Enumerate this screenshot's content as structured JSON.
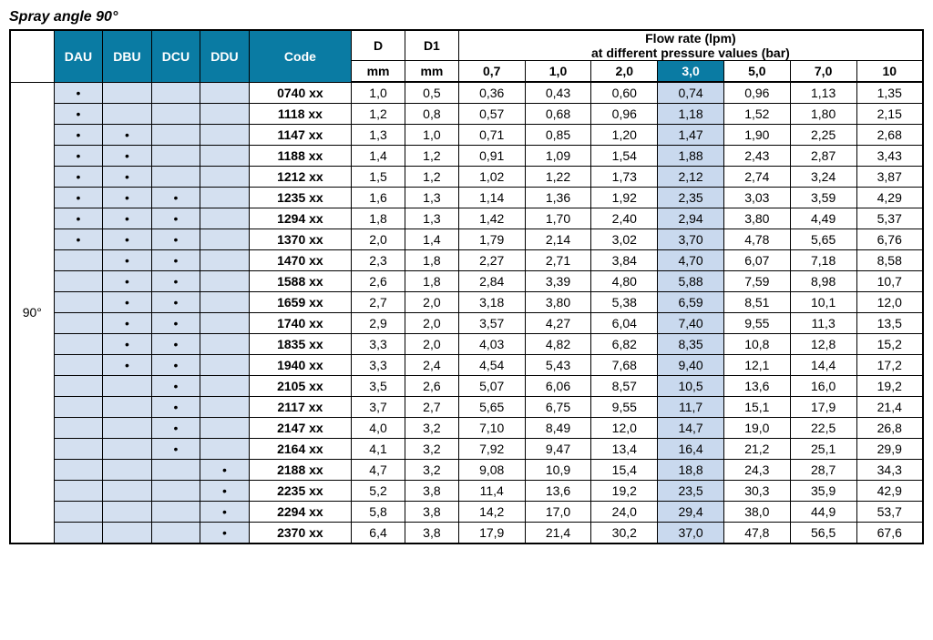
{
  "title": "Spray angle 90°",
  "angle_label": "90°",
  "headers": {
    "dau": "DAU",
    "dbu": "DBU",
    "dcu": "DCU",
    "ddu": "DDU",
    "code": "Code",
    "d": "D",
    "d1": "D1",
    "flow_title1": "Flow rate (lpm)",
    "flow_title2": "at different pressure values (bar)",
    "d_unit": "mm",
    "d1_unit": "mm",
    "pressures": [
      "0,7",
      "1,0",
      "2,0",
      "3,0",
      "5,0",
      "7,0",
      "10"
    ]
  },
  "rows": [
    {
      "dau": "•",
      "dbu": "",
      "dcu": "",
      "ddu": "",
      "code": "0740 xx",
      "d": "1,0",
      "d1": "0,5",
      "f": [
        "0,36",
        "0,43",
        "0,60",
        "0,74",
        "0,96",
        "1,13",
        "1,35"
      ]
    },
    {
      "dau": "•",
      "dbu": "",
      "dcu": "",
      "ddu": "",
      "code": "1118  xx",
      "d": "1,2",
      "d1": "0,8",
      "f": [
        "0,57",
        "0,68",
        "0,96",
        "1,18",
        "1,52",
        "1,80",
        "2,15"
      ]
    },
    {
      "dau": "•",
      "dbu": "•",
      "dcu": "",
      "ddu": "",
      "code": "1147  xx",
      "d": "1,3",
      "d1": "1,0",
      "f": [
        "0,71",
        "0,85",
        "1,20",
        "1,47",
        "1,90",
        "2,25",
        "2,68"
      ]
    },
    {
      "dau": "•",
      "dbu": "•",
      "dcu": "",
      "ddu": "",
      "code": "1188  xx",
      "d": "1,4",
      "d1": "1,2",
      "f": [
        "0,91",
        "1,09",
        "1,54",
        "1,88",
        "2,43",
        "2,87",
        "3,43"
      ]
    },
    {
      "dau": "•",
      "dbu": "•",
      "dcu": "",
      "ddu": "",
      "code": "1212  xx",
      "d": "1,5",
      "d1": "1,2",
      "f": [
        "1,02",
        "1,22",
        "1,73",
        "2,12",
        "2,74",
        "3,24",
        "3,87"
      ]
    },
    {
      "dau": "•",
      "dbu": "•",
      "dcu": "•",
      "ddu": "",
      "code": "1235  xx",
      "d": "1,6",
      "d1": "1,3",
      "f": [
        "1,14",
        "1,36",
        "1,92",
        "2,35",
        "3,03",
        "3,59",
        "4,29"
      ]
    },
    {
      "dau": "•",
      "dbu": "•",
      "dcu": "•",
      "ddu": "",
      "code": "1294  xx",
      "d": "1,8",
      "d1": "1,3",
      "f": [
        "1,42",
        "1,70",
        "2,40",
        "2,94",
        "3,80",
        "4,49",
        "5,37"
      ]
    },
    {
      "dau": "•",
      "dbu": "•",
      "dcu": "•",
      "ddu": "",
      "code": "1370  xx",
      "d": "2,0",
      "d1": "1,4",
      "f": [
        "1,79",
        "2,14",
        "3,02",
        "3,70",
        "4,78",
        "5,65",
        "6,76"
      ]
    },
    {
      "dau": "",
      "dbu": "•",
      "dcu": "•",
      "ddu": "",
      "code": "1470  xx",
      "d": "2,3",
      "d1": "1,8",
      "f": [
        "2,27",
        "2,71",
        "3,84",
        "4,70",
        "6,07",
        "7,18",
        "8,58"
      ]
    },
    {
      "dau": "",
      "dbu": "•",
      "dcu": "•",
      "ddu": "",
      "code": "1588  xx",
      "d": "2,6",
      "d1": "1,8",
      "f": [
        "2,84",
        "3,39",
        "4,80",
        "5,88",
        "7,59",
        "8,98",
        "10,7"
      ]
    },
    {
      "dau": "",
      "dbu": "•",
      "dcu": "•",
      "ddu": "",
      "code": "1659  xx",
      "d": "2,7",
      "d1": "2,0",
      "f": [
        "3,18",
        "3,80",
        "5,38",
        "6,59",
        "8,51",
        "10,1",
        "12,0"
      ]
    },
    {
      "dau": "",
      "dbu": "•",
      "dcu": "•",
      "ddu": "",
      "code": "1740  xx",
      "d": "2,9",
      "d1": "2,0",
      "f": [
        "3,57",
        "4,27",
        "6,04",
        "7,40",
        "9,55",
        "11,3",
        "13,5"
      ]
    },
    {
      "dau": "",
      "dbu": "•",
      "dcu": "•",
      "ddu": "",
      "code": "1835  xx",
      "d": "3,3",
      "d1": "2,0",
      "f": [
        "4,03",
        "4,82",
        "6,82",
        "8,35",
        "10,8",
        "12,8",
        "15,2"
      ]
    },
    {
      "dau": "",
      "dbu": "•",
      "dcu": "•",
      "ddu": "",
      "code": "1940  xx",
      "d": "3,3",
      "d1": "2,4",
      "f": [
        "4,54",
        "5,43",
        "7,68",
        "9,40",
        "12,1",
        "14,4",
        "17,2"
      ]
    },
    {
      "dau": "",
      "dbu": "",
      "dcu": "•",
      "ddu": "",
      "code": "2105  xx",
      "d": "3,5",
      "d1": "2,6",
      "f": [
        "5,07",
        "6,06",
        "8,57",
        "10,5",
        "13,6",
        "16,0",
        "19,2"
      ]
    },
    {
      "dau": "",
      "dbu": "",
      "dcu": "•",
      "ddu": "",
      "code": "2117  xx",
      "d": "3,7",
      "d1": "2,7",
      "f": [
        "5,65",
        "6,75",
        "9,55",
        "11,7",
        "15,1",
        "17,9",
        "21,4"
      ]
    },
    {
      "dau": "",
      "dbu": "",
      "dcu": "•",
      "ddu": "",
      "code": "2147  xx",
      "d": "4,0",
      "d1": "3,2",
      "f": [
        "7,10",
        "8,49",
        "12,0",
        "14,7",
        "19,0",
        "22,5",
        "26,8"
      ]
    },
    {
      "dau": "",
      "dbu": "",
      "dcu": "•",
      "ddu": "",
      "code": "2164  xx",
      "d": "4,1",
      "d1": "3,2",
      "f": [
        "7,92",
        "9,47",
        "13,4",
        "16,4",
        "21,2",
        "25,1",
        "29,9"
      ]
    },
    {
      "dau": "",
      "dbu": "",
      "dcu": "",
      "ddu": "•",
      "code": "2188  xx",
      "d": "4,7",
      "d1": "3,2",
      "f": [
        "9,08",
        "10,9",
        "15,4",
        "18,8",
        "24,3",
        "28,7",
        "34,3"
      ]
    },
    {
      "dau": "",
      "dbu": "",
      "dcu": "",
      "ddu": "•",
      "code": "2235  xx",
      "d": "5,2",
      "d1": "3,8",
      "f": [
        "11,4",
        "13,6",
        "19,2",
        "23,5",
        "30,3",
        "35,9",
        "42,9"
      ]
    },
    {
      "dau": "",
      "dbu": "",
      "dcu": "",
      "ddu": "•",
      "code": "2294  xx",
      "d": "5,8",
      "d1": "3,8",
      "f": [
        "14,2",
        "17,0",
        "24,0",
        "29,4",
        "38,0",
        "44,9",
        "53,7"
      ]
    },
    {
      "dau": "",
      "dbu": "",
      "dcu": "",
      "ddu": "•",
      "code": "2370  xx",
      "d": "6,4",
      "d1": "3,8",
      "f": [
        "17,9",
        "21,4",
        "30,2",
        "37,0",
        "47,8",
        "56,5",
        "67,6"
      ]
    }
  ]
}
